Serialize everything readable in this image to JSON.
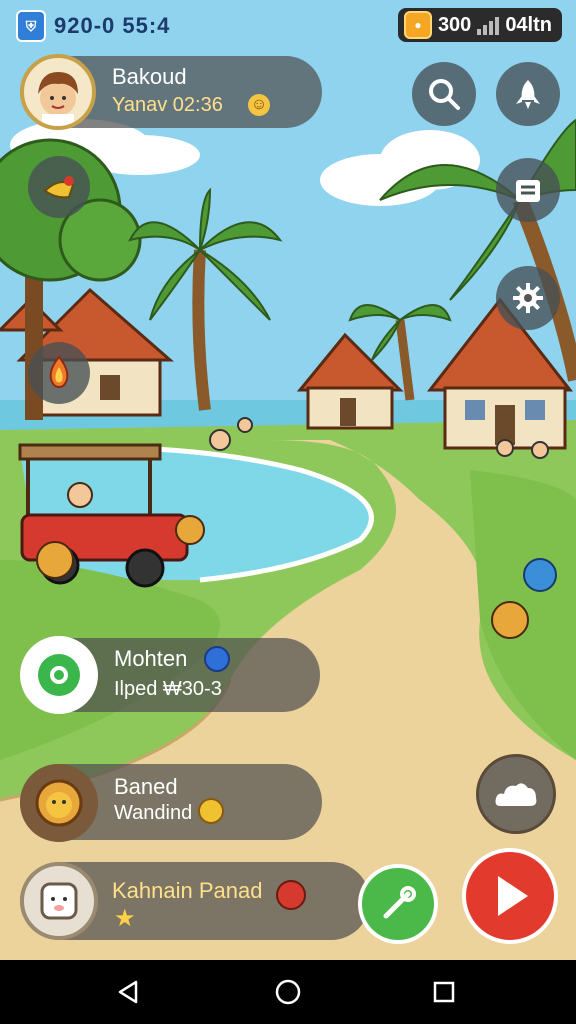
{
  "status_bar": {
    "left_text": "920-0  55:4",
    "right_count": "300",
    "right_text": "04ltn",
    "shield_icon": "shield-icon",
    "coin_icon": "coin-icon"
  },
  "profile": {
    "name": "Bakoud",
    "subtitle": "Yanav 02:36",
    "status_icon": "smiley-icon"
  },
  "top_right_buttons": [
    {
      "icon": "search-icon"
    },
    {
      "icon": "rocket-icon"
    },
    {
      "icon": "inventory-icon"
    },
    {
      "icon": "gear-icon"
    }
  ],
  "left_buttons": [
    {
      "icon": "hat-icon"
    },
    {
      "icon": "campfire-icon"
    }
  ],
  "cards": [
    {
      "title": "Mohten",
      "subtitle": "Ilped  ₩30-3",
      "icon": "green-badge-icon",
      "badge": "potion-icon"
    },
    {
      "title": "Baned",
      "subtitle": "Wandind",
      "icon": "lion-icon",
      "badge": "coin-bag-icon"
    },
    {
      "title": "Kahnain Panad",
      "subtitle": "",
      "icon": "sheep-icon",
      "badge": "apple-icon"
    }
  ],
  "actions": {
    "cloud_icon": "cloud-icon",
    "tool_icon": "wrench-icon",
    "play_icon": "play-icon"
  },
  "nav": {
    "back_icon": "back-icon",
    "home_icon": "home-icon",
    "recent_icon": "recent-apps-icon"
  }
}
